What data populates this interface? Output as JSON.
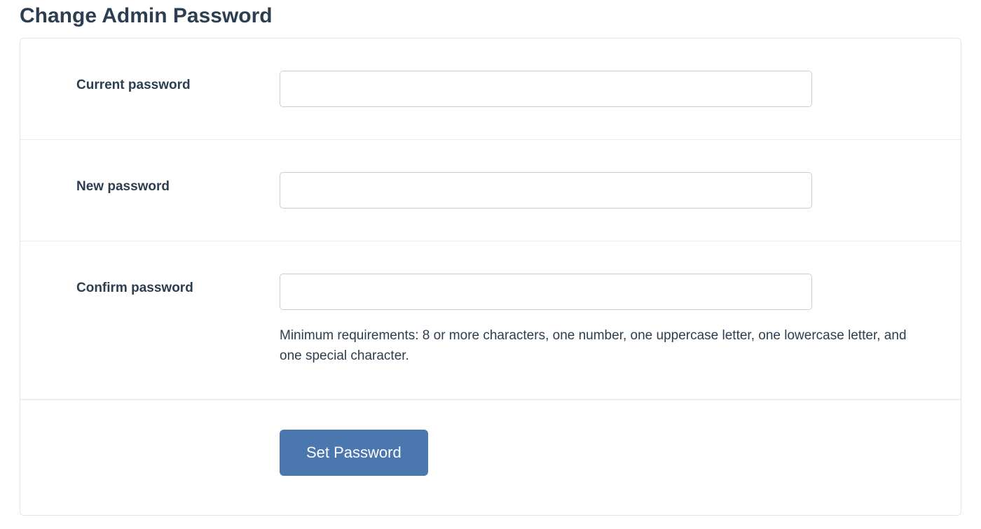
{
  "page": {
    "title": "Change Admin Password"
  },
  "form": {
    "current_password": {
      "label": "Current password",
      "value": ""
    },
    "new_password": {
      "label": "New password",
      "value": ""
    },
    "confirm_password": {
      "label": "Confirm password",
      "value": "",
      "helper": "Minimum requirements: 8 or more characters, one number, one uppercase letter, one lowercase letter, and one special character."
    },
    "submit_label": "Set Password"
  }
}
